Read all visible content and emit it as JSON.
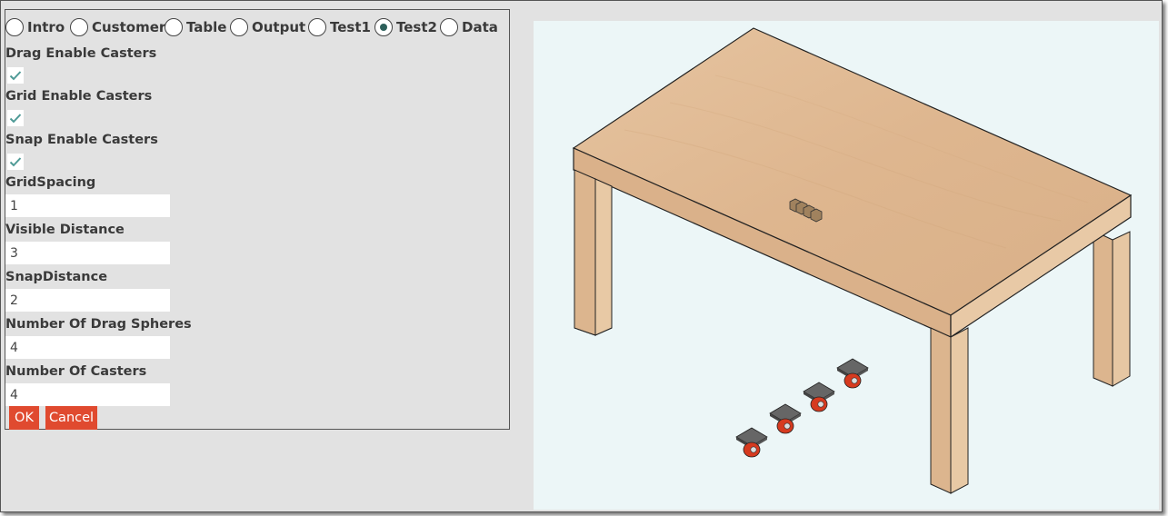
{
  "tabs": [
    {
      "label": "Intro",
      "checked": false
    },
    {
      "label": "Customer",
      "checked": false
    },
    {
      "label": "Table",
      "checked": false
    },
    {
      "label": "Output",
      "checked": false
    },
    {
      "label": "Test1",
      "checked": false
    },
    {
      "label": "Test2",
      "checked": true
    },
    {
      "label": "Data",
      "checked": false
    }
  ],
  "form": {
    "drag_enable_label": "Drag Enable Casters",
    "drag_enable_checked": true,
    "grid_enable_label": "Grid Enable Casters",
    "grid_enable_checked": true,
    "snap_enable_label": "Snap Enable Casters",
    "snap_enable_checked": true,
    "grid_spacing_label": "GridSpacing",
    "grid_spacing_value": "1",
    "visible_distance_label": "Visible Distance",
    "visible_distance_value": "3",
    "snap_distance_label": "SnapDistance",
    "snap_distance_value": "2",
    "drag_spheres_label": "Number Of Drag Spheres",
    "drag_spheres_value": "4",
    "casters_label": "Number Of Casters",
    "casters_value": "4"
  },
  "buttons": {
    "ok": "OK",
    "cancel": "Cancel"
  },
  "colors": {
    "accent": "#e04a2f",
    "radio_selected": "#2c5f5a",
    "check": "#4e9a96",
    "viewport_bg": "#ecf6f7",
    "wood": "#deb791",
    "caster_wheel": "#d63a1f"
  }
}
